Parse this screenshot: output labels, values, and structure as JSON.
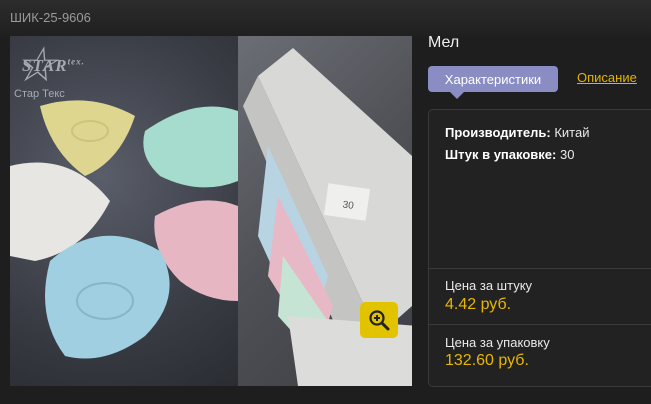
{
  "product": {
    "sku": "ШИК-25-9606",
    "name": "Мел",
    "logo_text": "STAR",
    "logo_sub": "tex.",
    "logo_caption": "Стар Текс",
    "box_label": "30"
  },
  "tabs": {
    "characteristics": "Характеристики",
    "description": "Описание"
  },
  "specs": {
    "manufacturer_label": "Производитель:",
    "manufacturer_value": "Китай",
    "pack_qty_label": "Штук в упаковке:",
    "pack_qty_value": "30"
  },
  "prices": {
    "unit_label": "Цена за штуку",
    "unit_value": "4.42 руб.",
    "pack_label": "Цена за упаковку",
    "pack_value": "132.60 руб."
  },
  "colors": {
    "accent": "#e3b400",
    "tab_active": "#8a8cc4",
    "background": "#1e1e1e"
  },
  "icons": {
    "zoom": "zoom-in-icon"
  }
}
